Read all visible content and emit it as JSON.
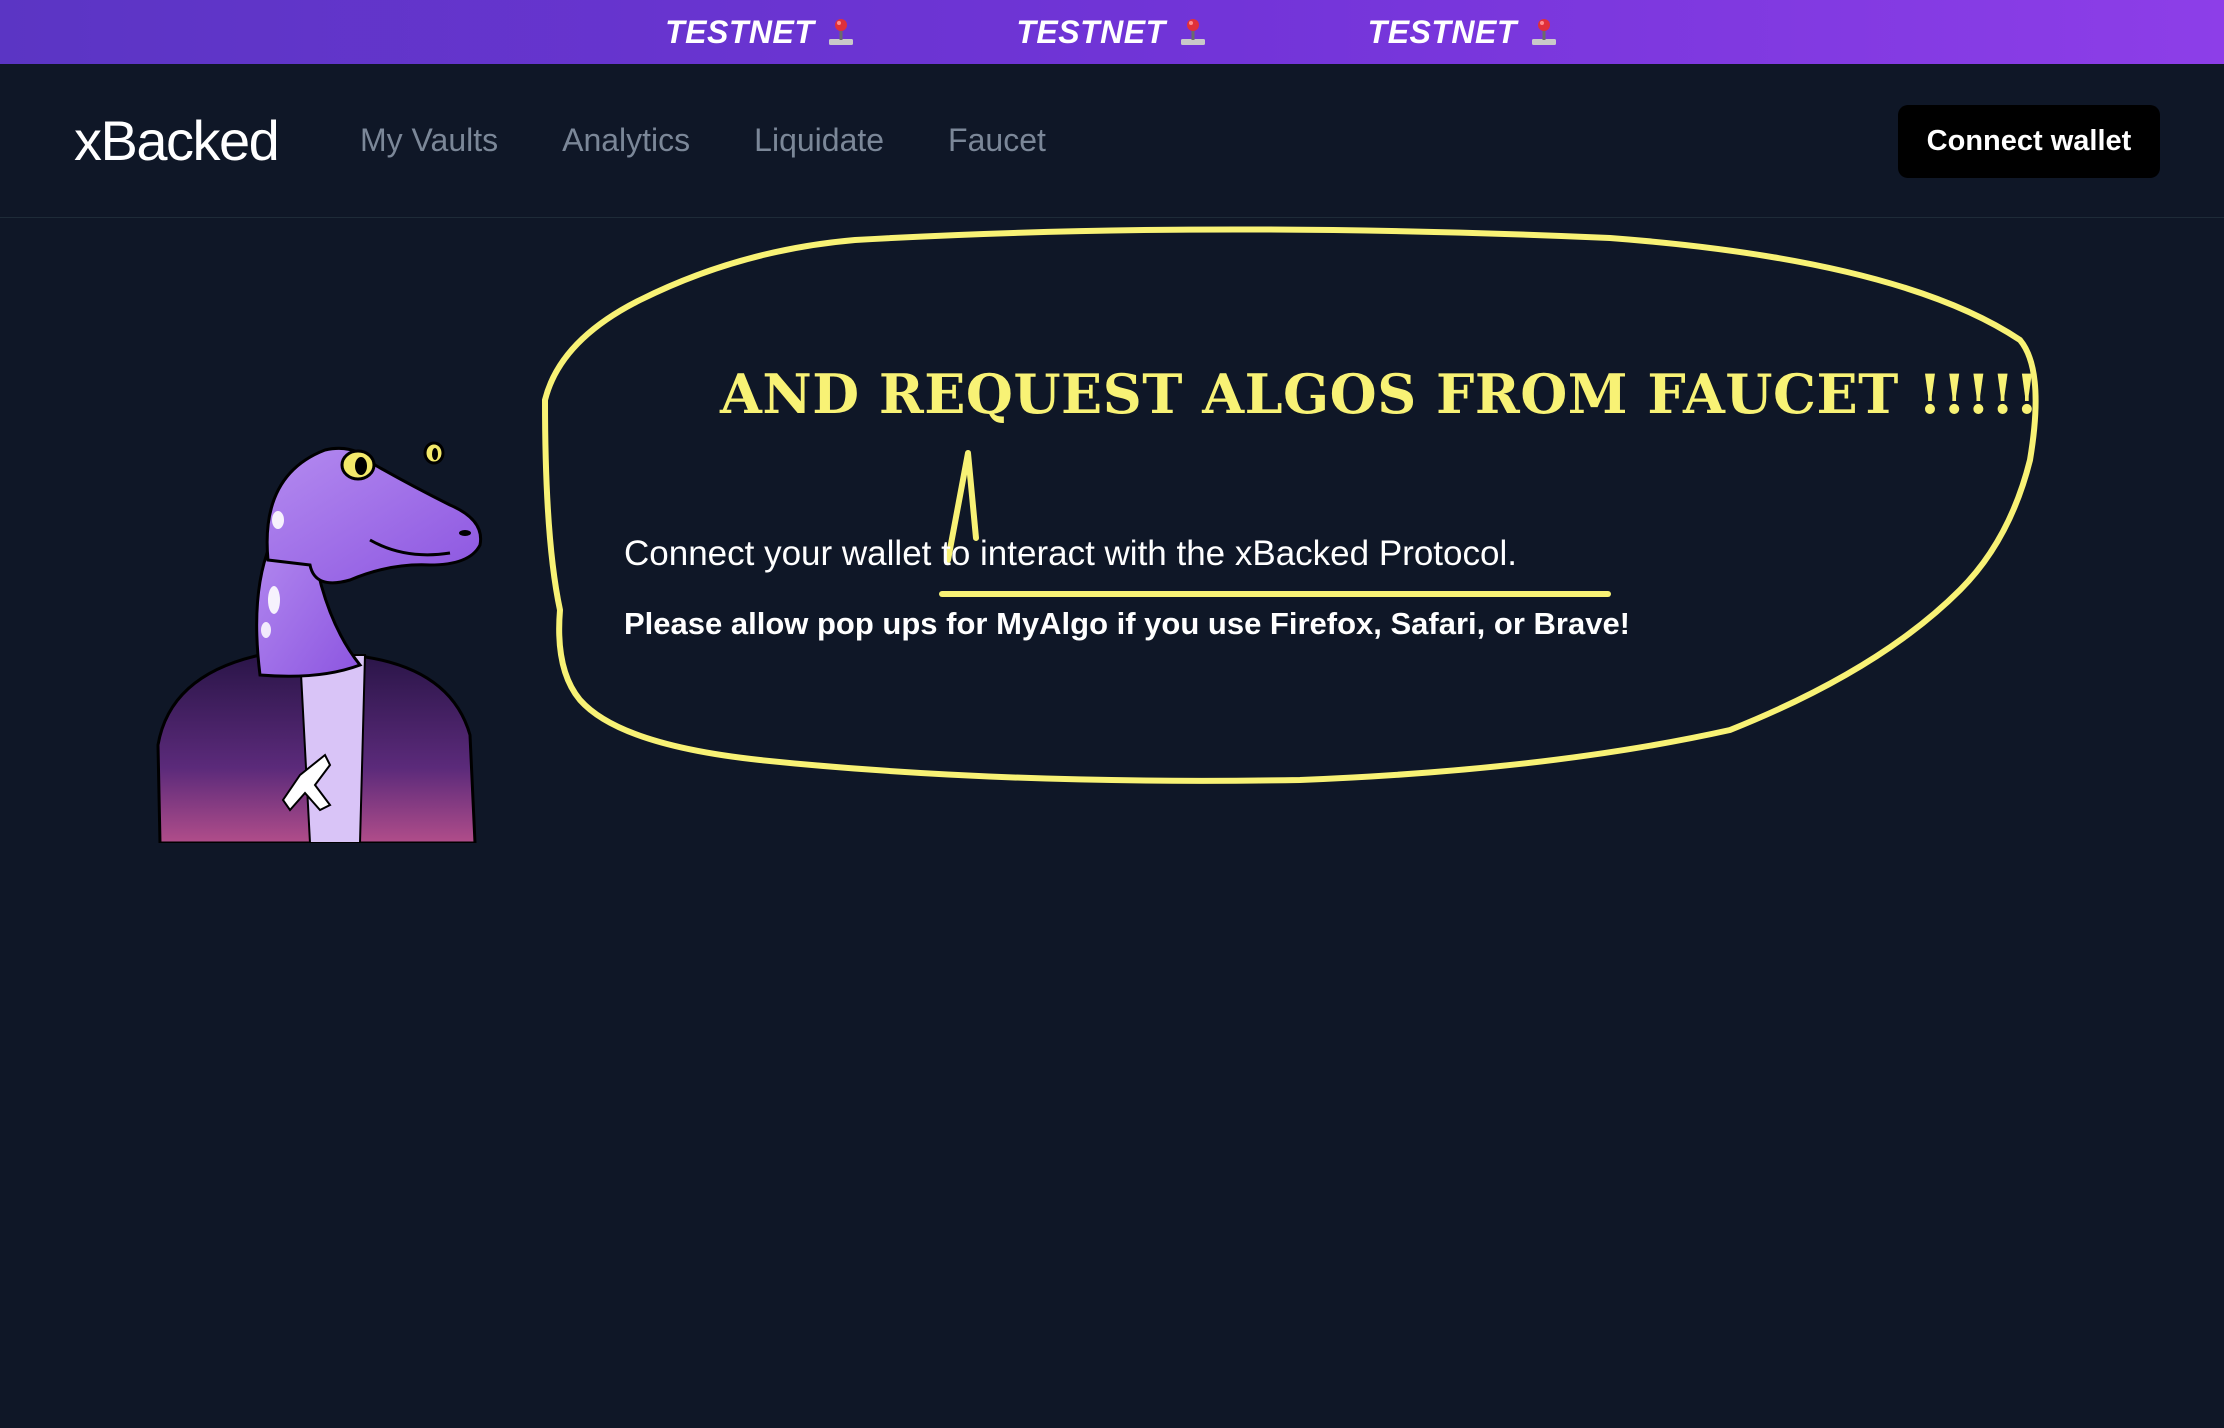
{
  "banner": {
    "items": [
      "TESTNET",
      "TESTNET",
      "TESTNET"
    ],
    "icon": "joystick-icon",
    "gradient_start": "#5b35c4",
    "gradient_end": "#8d3ee8"
  },
  "navbar": {
    "brand": "xBacked",
    "links": [
      "My Vaults",
      "Analytics",
      "Liquidate",
      "Faucet"
    ],
    "connect_button": "Connect wallet"
  },
  "main": {
    "annotation": "AND REQUEST ALGOS FROM FAUCET !!!!!",
    "annotation_color": "#f8f275",
    "connect_message": "Connect your wallet to interact with the xBacked Protocol.",
    "popup_message": "Please allow pop ups for MyAlgo if you use Firefox, Safari, or Brave!",
    "mascot": "lizard-mascot-illustration"
  },
  "colors": {
    "background": "#0f1727",
    "nav_text": "#7b8798",
    "button_bg": "#000000"
  }
}
